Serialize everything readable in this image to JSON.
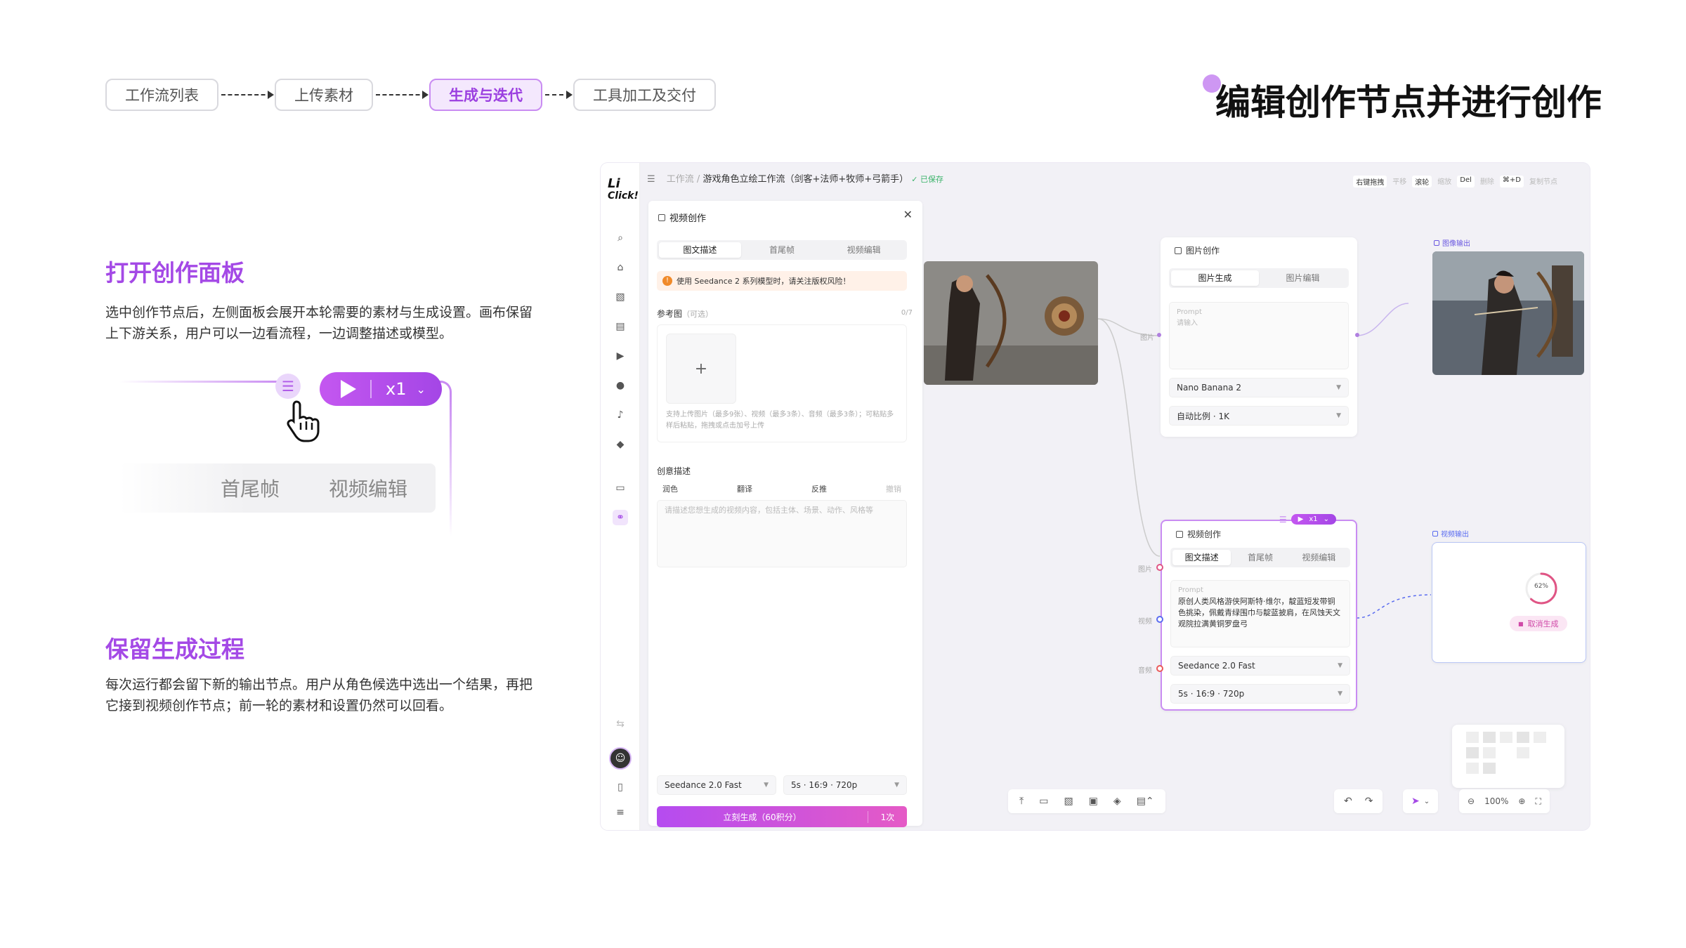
{
  "steps": [
    "工作流列表",
    "上传素材",
    "生成与迭代",
    "工具加工及交付"
  ],
  "active_step_index": 2,
  "main_title": "编辑创作节点并进行创作",
  "section1": {
    "title": "打开创作面板",
    "body": "选中创作节点后，左侧面板会展开本轮需要的素材与生成设置。画布保留上下游关系，用户可以一边看流程，一边调整描述或模型。"
  },
  "section2": {
    "title": "保留生成过程",
    "body": "每次运行都会留下新的输出节点。用户从角色候选中选出一个结果，再把它接到视频创作节点；前一轮的素材和设置仍然可以回看。"
  },
  "demo": {
    "count": "x1",
    "tab1": "首尾帧",
    "tab2": "视频编辑"
  },
  "app": {
    "logo_line1": "Li",
    "logo_line2": "Click!",
    "breadcrumb_root": "工作流 /",
    "breadcrumb_title": "游戏角色立绘工作流（剑客+法师+牧师+弓箭手）",
    "saved": "✓ 已保存",
    "shortcuts": [
      {
        "key": "右键拖拽",
        "label": "平移"
      },
      {
        "key": "滚轮",
        "label": "缩放"
      },
      {
        "key": "Del",
        "label": "删除"
      },
      {
        "key": "⌘+D",
        "label": "复制节点"
      }
    ],
    "panel": {
      "title": "视频创作",
      "tabs": [
        "图文描述",
        "首尾帧",
        "视频编辑"
      ],
      "warning": "使用 Seedance 2 系列模型时，请关注版权风险！",
      "ref_label": "参考图",
      "ref_optional": "（可选）",
      "ref_count": "0/7",
      "upload_hint": "支持上传图片（最多9张）、视频（最多3条）、音频（最多3条）；可粘贴多样后粘贴，拖拽或点击加号上传",
      "desc_label": "创意描述",
      "tools": [
        "润色",
        "翻译",
        "反推",
        "撤销"
      ],
      "desc_placeholder": "请描述您想生成的视频内容，包括主体、场景、动作、风格等",
      "model": "Seedance 2.0 Fast",
      "spec": "5s · 16:9 · 720p",
      "generate": "立刻生成（60积分）",
      "times": "1次"
    },
    "image_node": {
      "title": "图片创作",
      "tabs": [
        "图片生成",
        "图片编辑"
      ],
      "prompt_label": "Prompt",
      "prompt_placeholder": "请输入",
      "model": "Nano Banana 2",
      "ratio": "自动比例 · 1K",
      "input_label": "图片"
    },
    "image_output_label": "图像输出",
    "video_node": {
      "title": "视频创作",
      "tabs": [
        "图文描述",
        "首尾帧",
        "视频编辑"
      ],
      "prompt_label": "Prompt",
      "prompt_text": "原创人类风格游侠阿斯特·维尔，靛蓝短发带铜色挑染，佩戴青绿围巾与靛蓝披肩，在风蚀天文观院拉满黄铜罗盘弓",
      "model": "Seedance 2.0 Fast",
      "spec": "5s · 16:9 · 720p",
      "count": "x1",
      "ports": [
        "图片",
        "视频",
        "音频"
      ]
    },
    "video_output": {
      "label": "视频输出",
      "progress": 62,
      "progress_text": "62%",
      "cancel": "取消生成"
    },
    "zoom": "100%"
  },
  "colors": {
    "accent": "#a449e6",
    "accent_light": "#f4e8fd",
    "port_pink": "#e05585",
    "port_blue": "#5a6cf0",
    "port_red": "#ea5a5a"
  }
}
